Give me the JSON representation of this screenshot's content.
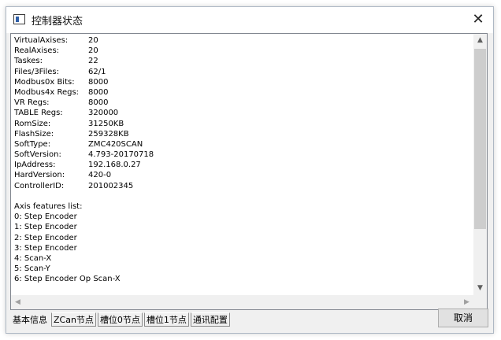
{
  "window": {
    "title": "控制器状态",
    "close_glyph": "✕"
  },
  "info": {
    "rows": [
      {
        "key": "VirtualAxises:",
        "value": "20"
      },
      {
        "key": "RealAxises:",
        "value": "20"
      },
      {
        "key": "Taskes:",
        "value": "22"
      },
      {
        "key": "Files/3Files:",
        "value": "62/1"
      },
      {
        "key": "Modbus0x Bits:",
        "value": "8000"
      },
      {
        "key": "Modbus4x Regs:",
        "value": "8000"
      },
      {
        "key": "VR Regs:",
        "value": "8000"
      },
      {
        "key": "TABLE Regs:",
        "value": "320000"
      },
      {
        "key": "RomSize:",
        "value": "31250KB"
      },
      {
        "key": "FlashSize:",
        "value": "259328KB"
      },
      {
        "key": "SoftType:",
        "value": "ZMC420SCAN"
      },
      {
        "key": "SoftVersion:",
        "value": "4.793-20170718"
      },
      {
        "key": "IpAddress:",
        "value": "192.168.0.27"
      },
      {
        "key": "HardVersion:",
        "value": "420-0"
      },
      {
        "key": "ControllerID:",
        "value": "201002345"
      }
    ],
    "axis_heading": "Axis features list:",
    "axis_lines": [
      "0: Step Encoder",
      "1: Step Encoder",
      "2: Step Encoder",
      "3: Step Encoder",
      "4: Scan-X",
      "5: Scan-Y",
      "6: Step Encoder Op Scan-X"
    ]
  },
  "tabs": [
    {
      "label": "基本信息",
      "active": true
    },
    {
      "label": "ZCan节点",
      "active": false
    },
    {
      "label": "槽位0节点",
      "active": false
    },
    {
      "label": "槽位1节点",
      "active": false
    },
    {
      "label": "通讯配置",
      "active": false
    }
  ],
  "buttons": {
    "cancel_label": "取消"
  },
  "icons": {
    "window_icon": "app-window-icon",
    "close_icon": "close-icon",
    "scroll_up": "▲",
    "scroll_down": "▼",
    "scroll_left": "◀",
    "scroll_right": "▶"
  }
}
